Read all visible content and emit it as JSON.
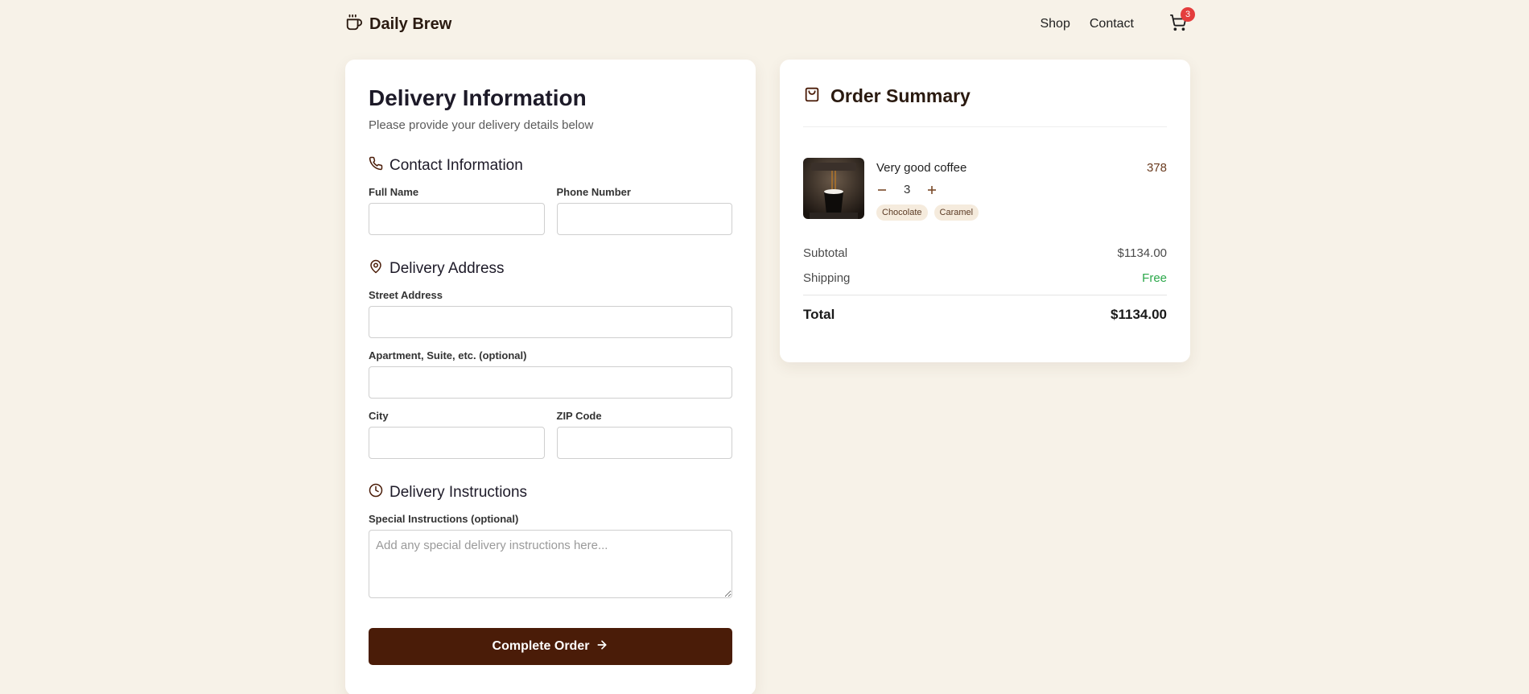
{
  "header": {
    "brand": "Daily Brew",
    "nav": [
      "Shop",
      "Contact"
    ],
    "cart_count": "3"
  },
  "delivery": {
    "title": "Delivery Information",
    "subtitle": "Please provide your delivery details below",
    "contact": {
      "heading": "Contact Information",
      "full_name_label": "Full Name",
      "phone_label": "Phone Number"
    },
    "address": {
      "heading": "Delivery Address",
      "street_label": "Street Address",
      "apartment_label": "Apartment, Suite, etc. (optional)",
      "city_label": "City",
      "zip_label": "ZIP Code"
    },
    "instructions": {
      "heading": "Delivery Instructions",
      "label": "Special Instructions (optional)",
      "placeholder": "Add any special delivery instructions here..."
    },
    "submit_label": "Complete Order"
  },
  "summary": {
    "title": "Order Summary",
    "item": {
      "name": "Very good coffee",
      "price": "378",
      "quantity": "3",
      "tags": [
        "Chocolate",
        "Caramel"
      ]
    },
    "subtotal_label": "Subtotal",
    "subtotal_value": "$1134.00",
    "shipping_label": "Shipping",
    "shipping_value": "Free",
    "total_label": "Total",
    "total_value": "$1134.00"
  },
  "colors": {
    "background": "#f7f2e8",
    "primary": "#4a1c08",
    "badge": "#e43d3d",
    "free": "#2ba84a"
  }
}
